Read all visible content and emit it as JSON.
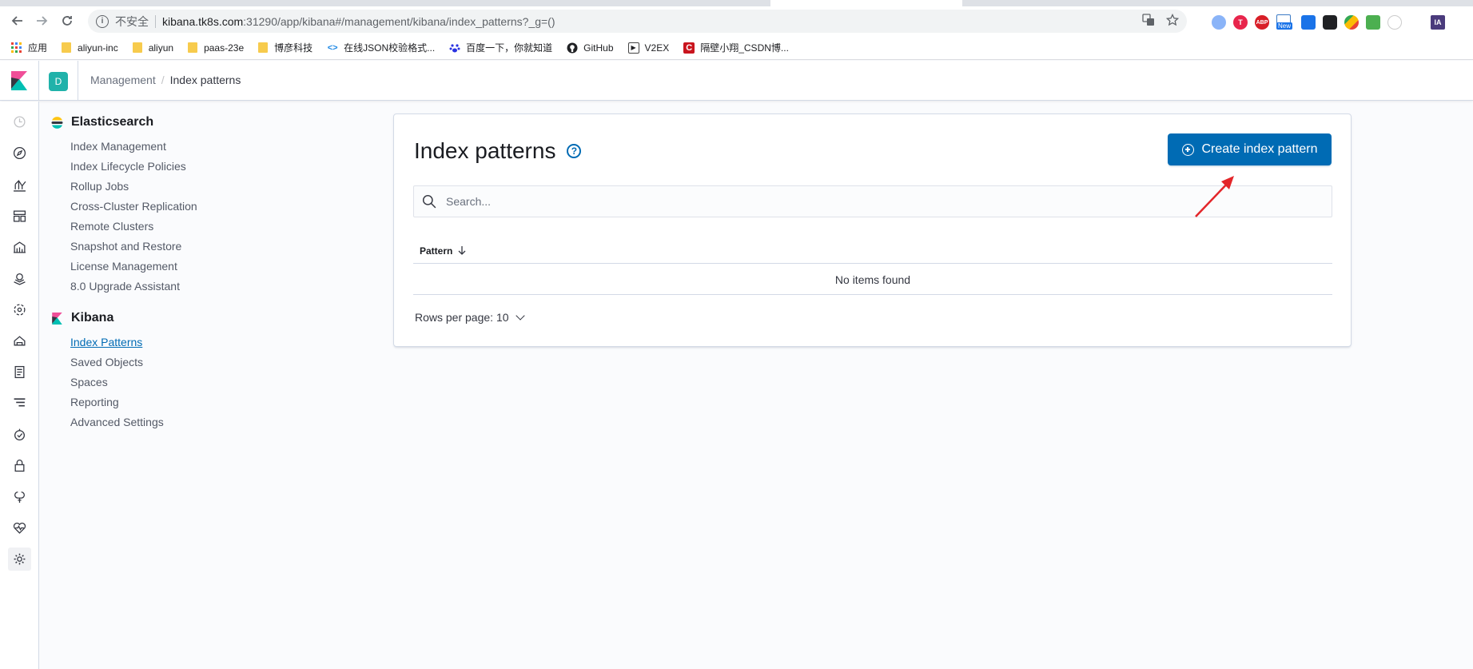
{
  "browser": {
    "address_insecure_label": "不安全",
    "address_host": "kibana.tk8s.com",
    "address_rest": ":31290/app/kibana#/management/kibana/index_patterns?_g=()",
    "bookmarks": [
      {
        "label": "应用",
        "icon": "apps-grid-icon"
      },
      {
        "label": "aliyun-inc",
        "icon": "folder-icon"
      },
      {
        "label": "aliyun",
        "icon": "folder-icon"
      },
      {
        "label": "paas-23e",
        "icon": "folder-icon"
      },
      {
        "label": "博彦科技",
        "icon": "folder-icon"
      },
      {
        "label": "在线JSON校验格式...",
        "icon": "code-icon"
      },
      {
        "label": "百度一下，你就知道",
        "icon": "baidu-paw-icon"
      },
      {
        "label": "GitHub",
        "icon": "github-icon"
      },
      {
        "label": "V2EX",
        "icon": "v2ex-icon"
      },
      {
        "label": "隔壁小翔_CSDN博...",
        "icon": "csdn-icon"
      }
    ],
    "extensions_new_badge": "New",
    "extensions_abp": "ABP",
    "extensions_ia": "IA"
  },
  "header": {
    "space_initial": "D",
    "breadcrumbs": {
      "parent": "Management",
      "current": "Index patterns"
    }
  },
  "sidenav": {
    "groups": [
      {
        "title": "Elasticsearch",
        "items": [
          "Index Management",
          "Index Lifecycle Policies",
          "Rollup Jobs",
          "Cross-Cluster Replication",
          "Remote Clusters",
          "Snapshot and Restore",
          "License Management",
          "8.0 Upgrade Assistant"
        ]
      },
      {
        "title": "Kibana",
        "items": [
          "Index Patterns",
          "Saved Objects",
          "Spaces",
          "Reporting",
          "Advanced Settings"
        ],
        "selected": "Index Patterns"
      }
    ]
  },
  "main": {
    "title": "Index patterns",
    "create_button_label": "Create index pattern",
    "search_placeholder": "Search...",
    "table": {
      "column_pattern": "Pattern",
      "empty_message": "No items found"
    },
    "rows_per_page_label": "Rows per page: 10"
  },
  "colors": {
    "primary": "#006bb4",
    "space_badge": "#20b2aa",
    "annotation": "#e3262a"
  }
}
